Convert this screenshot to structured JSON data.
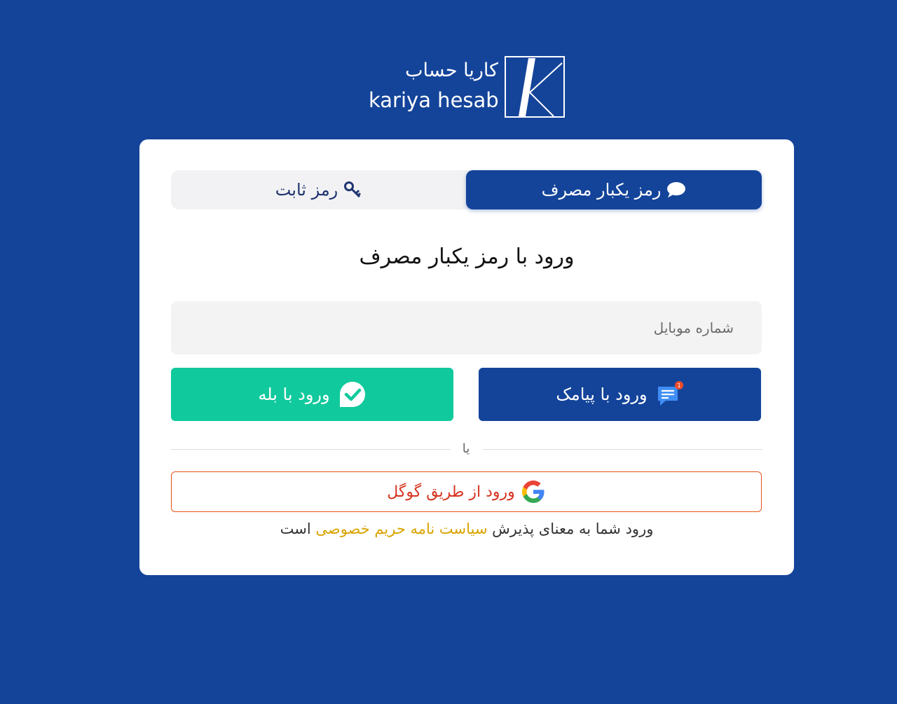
{
  "brand": {
    "name_fa": "کاریا حساب",
    "name_en": "kariya hesab"
  },
  "tabs": [
    {
      "label": "رمز یکبار مصرف",
      "icon": "chat-bubble-icon",
      "active": true
    },
    {
      "label": "رمز ثابت",
      "icon": "key-icon",
      "active": false
    }
  ],
  "form": {
    "title": "ورود با رمز یکبار مصرف",
    "phone_placeholder": "شماره موبایل",
    "phone_value": ""
  },
  "buttons": {
    "sms_label": "ورود با پیامک",
    "sms_badge": "1",
    "bale_label": "ورود با بله",
    "divider_text": "یا",
    "google_label": "ورود از طریق گوگل"
  },
  "policy": {
    "before": "ورود شما به معنای پذیرش",
    "link": "سیاست نامه حریم خصوصی",
    "after": "است"
  },
  "colors": {
    "background": "#14449a",
    "primary": "#14449a",
    "bale_green": "#10c99c",
    "google_red": "#d6331f",
    "link_gold": "#d9a300"
  }
}
